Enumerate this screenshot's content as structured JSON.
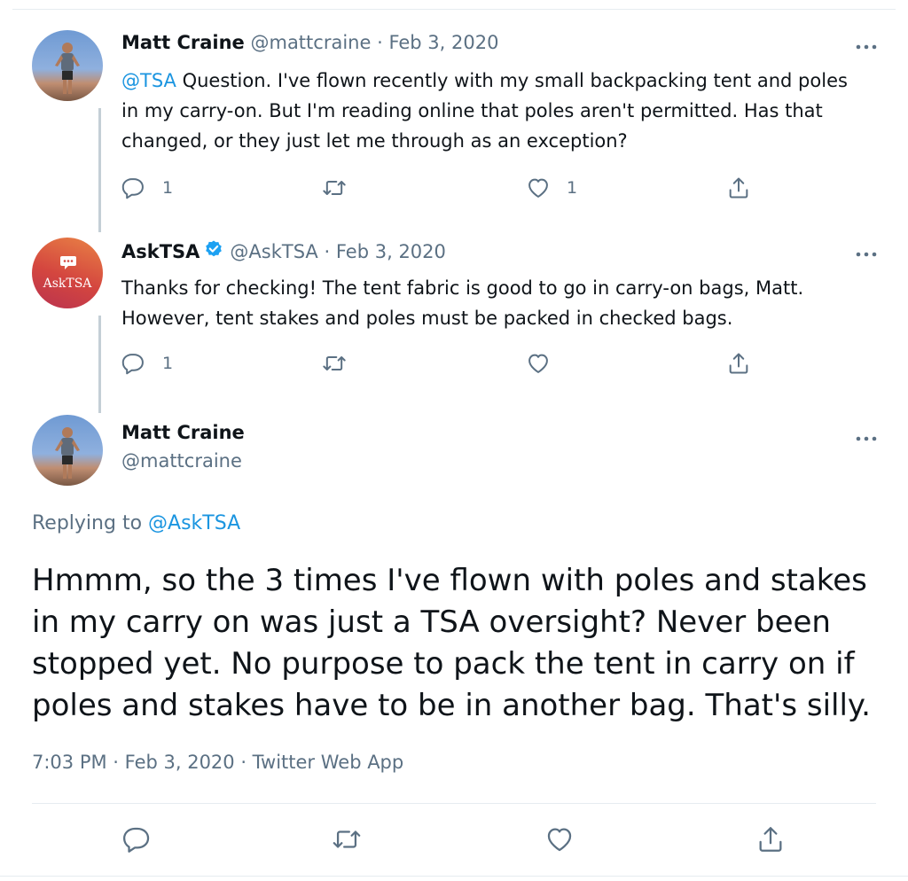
{
  "tweets": [
    {
      "name": "Matt Craine",
      "handle": "@mattcraine",
      "separator": "·",
      "date": "Feb 3, 2020",
      "mention": "@TSA",
      "text": " Question. I've flown recently with my small backpacking tent and poles in my carry-on. But I'm reading online that poles aren't permitted. Has that changed, or they  just let me through as an exception?",
      "reply_count": "1",
      "retweet_count": "",
      "like_count": "1"
    },
    {
      "name": "AskTSA",
      "verified": true,
      "handle": "@AskTSA",
      "separator": "·",
      "date": "Feb 3, 2020",
      "avatar_text": "AskTSA",
      "text": "Thanks for checking! The tent fabric is good to go in carry-on bags, Matt. However, tent stakes and poles must be packed in checked bags.",
      "reply_count": "1",
      "retweet_count": "",
      "like_count": ""
    }
  ],
  "main_tweet": {
    "name": "Matt Craine",
    "handle": "@mattcraine",
    "replying_prefix": "Replying to ",
    "replying_to": "@AskTSA",
    "text": "Hmmm, so the 3 times I've flown with poles and stakes in my carry on was just a TSA oversight?  Never been stopped yet. No purpose to pack the tent in carry on if poles and stakes have to be in another bag. That's silly.",
    "meta": "7:03 PM · Feb 3, 2020 · Twitter Web App"
  },
  "icons": {
    "reply": "reply-icon",
    "retweet": "retweet-icon",
    "like": "heart-icon",
    "share": "share-icon",
    "more": "more-icon",
    "verified": "verified-badge-icon"
  },
  "colors": {
    "link": "#1b95e0",
    "muted": "#5b7083",
    "text": "#0f1419",
    "verified": "#1da1f2"
  }
}
